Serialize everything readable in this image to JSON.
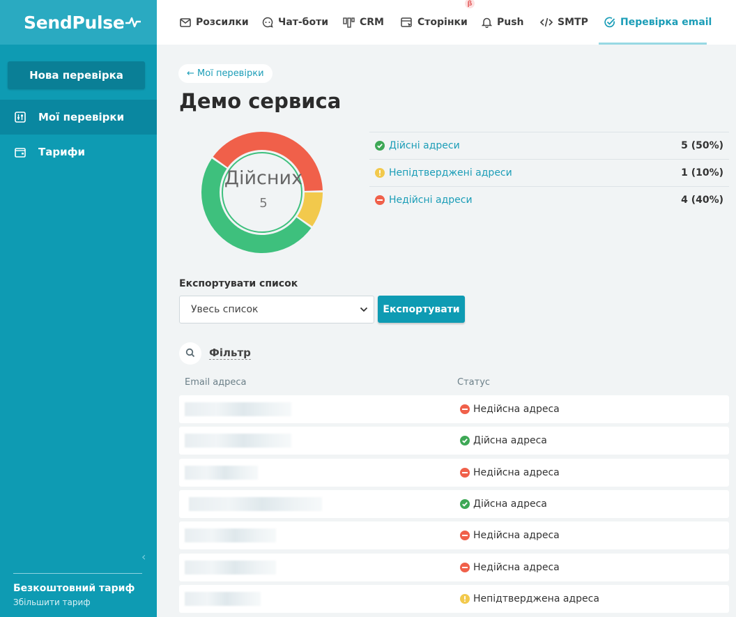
{
  "brand": {
    "logo_text": "SendPulse"
  },
  "sidebar": {
    "new_check_label": "Нова перевірка",
    "items": [
      {
        "label": "Мої перевірки",
        "icon": "sliders-icon",
        "active": true
      },
      {
        "label": "Тарифи",
        "icon": "wallet-icon",
        "active": false
      }
    ],
    "plan_name": "Безкоштовний тариф",
    "plan_upgrade": "Збільшити тариф"
  },
  "topnav": {
    "items": [
      {
        "label": "Розсилки",
        "icon": "envelope-icon"
      },
      {
        "label": "Чат-боти",
        "icon": "chat-icon"
      },
      {
        "label": "CRM",
        "icon": "columns-icon"
      },
      {
        "label": "Сторінки",
        "icon": "page-icon",
        "badge": "β"
      },
      {
        "label": "Push",
        "icon": "bell-icon"
      },
      {
        "label": "SMTP",
        "icon": "code-icon"
      },
      {
        "label": "Перевірка email",
        "icon": "check-circle-icon",
        "active": true
      }
    ]
  },
  "main": {
    "back_link": "← Мої перевірки",
    "title": "Демо сервиса",
    "donut": {
      "label": "Дійсних",
      "value": "5"
    },
    "chart_data": {
      "type": "pie",
      "categories": [
        "Дійсні адреси",
        "Непідтверджені адреси",
        "Недійсні адреси"
      ],
      "values": [
        5,
        1,
        4
      ],
      "colors": [
        "#3ec07d",
        "#f2c94c",
        "#f0604a"
      ]
    },
    "stats": [
      {
        "label": "Дійсні адреси",
        "value": "5 (50%)",
        "kind": "valid"
      },
      {
        "label": "Непідтверджені адреси",
        "value": "1 (10%)",
        "kind": "unconfirmed"
      },
      {
        "label": "Недійсні адреси",
        "value": "4 (40%)",
        "kind": "invalid"
      }
    ],
    "export": {
      "label": "Експортувати список",
      "selected": "Увесь список",
      "button": "Експортувати"
    },
    "filter_label": "Фільтр",
    "table": {
      "headers": {
        "email": "Email адреса",
        "status": "Статус"
      },
      "rows": [
        {
          "status": "Недійсна адреса",
          "kind": "invalid"
        },
        {
          "status": "Дійсна адреса",
          "kind": "valid"
        },
        {
          "status": "Недійсна адреса",
          "kind": "invalid"
        },
        {
          "status": "Дійсна адреса",
          "kind": "valid"
        },
        {
          "status": "Недійсна адреса",
          "kind": "invalid"
        },
        {
          "status": "Недійсна адреса",
          "kind": "invalid"
        },
        {
          "status": "Непідтверджена адреса",
          "kind": "unconfirmed"
        }
      ]
    }
  },
  "colors": {
    "accent": "#0e9bb3",
    "valid": "#3ea856",
    "unconfirmed": "#f2c94c",
    "invalid": "#f0604a"
  }
}
